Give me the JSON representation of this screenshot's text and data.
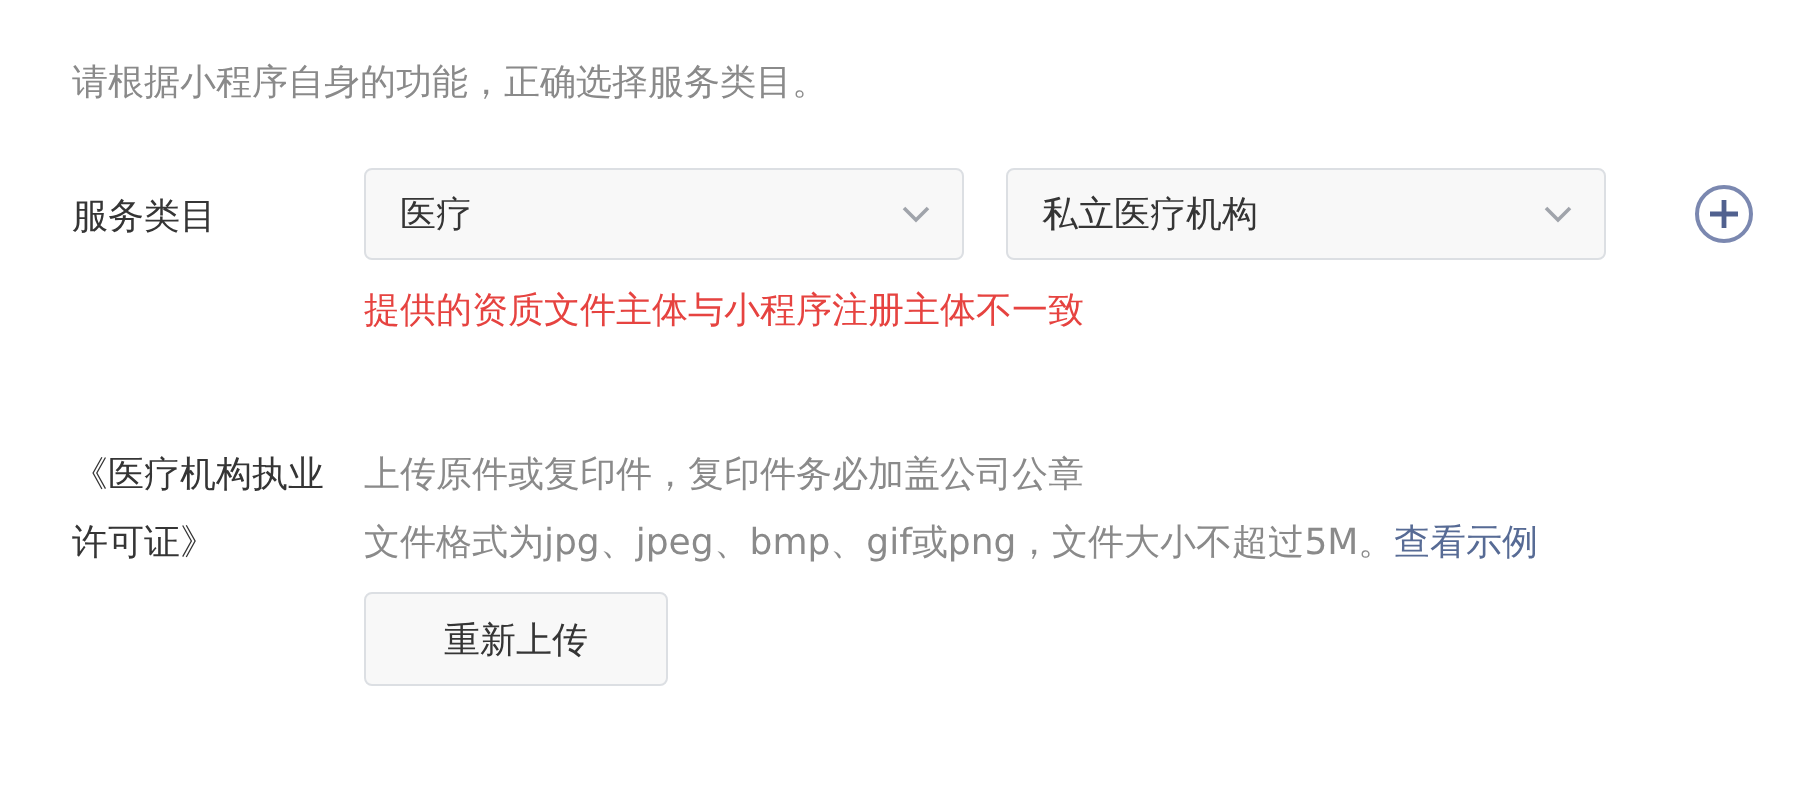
{
  "intro": "请根据小程序自身的功能，正确选择服务类目。",
  "category": {
    "label": "服务类目",
    "selects": [
      {
        "value": "医疗"
      },
      {
        "value": "私立医疗机构"
      }
    ],
    "error": "提供的资质文件主体与小程序注册主体不一致"
  },
  "license": {
    "label": "《医疗机构执业许可证》",
    "hint": "上传原件或复印件，复印件务必加盖公司公章",
    "format": "文件格式为jpg、jpeg、bmp、gif或png，文件大小不超过5M。",
    "example_link": "查看示例",
    "button": "重新上传"
  }
}
